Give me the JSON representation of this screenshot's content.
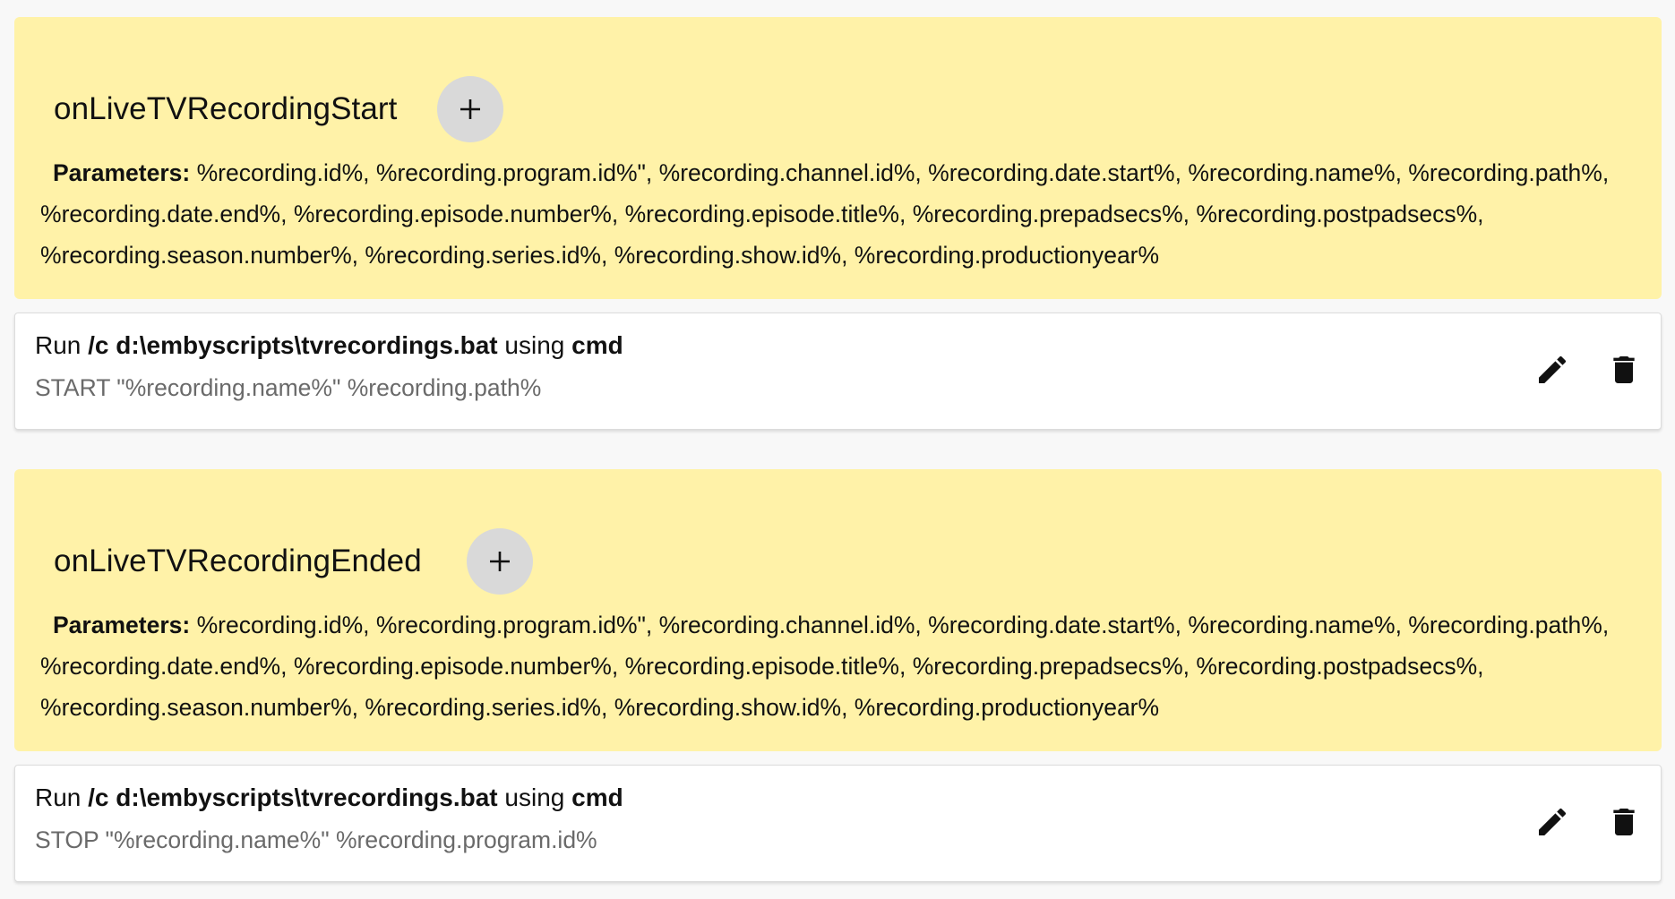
{
  "events": [
    {
      "title": "onLiveTVRecordingStart",
      "params_label": "Parameters:",
      "params_text": "%recording.id%, %recording.program.id%\", %recording.channel.id%, %recording.date.start%, %recording.name%, %recording.path%, %recording.date.end%, %recording.episode.number%, %recording.episode.title%, %recording.prepadsecs%, %recording.postpadsecs%, %recording.season.number%, %recording.series.id%, %recording.show.id%, %recording.productionyear%",
      "add_icon": "plus-icon",
      "action": {
        "run_label": "Run",
        "command": "/c d:\\embyscripts\\tvrecordings.bat",
        "using_label": "using",
        "program": "cmd",
        "args": "START \"%recording.name%\" %recording.path%",
        "edit_icon": "pencil-icon",
        "delete_icon": "trash-icon"
      }
    },
    {
      "title": "onLiveTVRecordingEnded",
      "params_label": "Parameters:",
      "params_text": "%recording.id%, %recording.program.id%\", %recording.channel.id%, %recording.date.start%, %recording.name%, %recording.path%, %recording.date.end%, %recording.episode.number%, %recording.episode.title%, %recording.prepadsecs%, %recording.postpadsecs%, %recording.season.number%, %recording.series.id%, %recording.show.id%, %recording.productionyear%",
      "add_icon": "plus-icon",
      "action": {
        "run_label": "Run",
        "command": "/c d:\\embyscripts\\tvrecordings.bat",
        "using_label": "using",
        "program": "cmd",
        "args": "STOP \"%recording.name%\" %recording.program.id%",
        "edit_icon": "pencil-icon",
        "delete_icon": "trash-icon"
      }
    }
  ],
  "colors": {
    "header_bg": "#fff2a8",
    "add_button_bg": "#d9d9d9",
    "args_text": "#6a6a6a"
  }
}
